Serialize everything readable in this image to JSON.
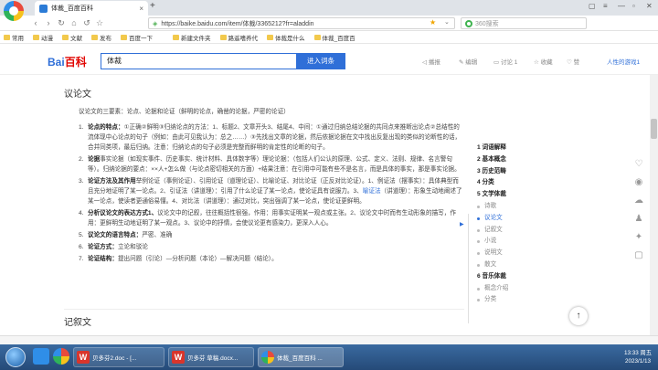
{
  "browser": {
    "tab_title": "体裁_百度百科",
    "url": "https://baike.baidu.com/item/体裁/3365212?fr=aladdin",
    "search_placeholder": "360搜索",
    "bookmarks": [
      "常用",
      "动漫",
      "文献",
      "发布",
      "百度一下",
      "新建文件夹",
      "路遥嗜养代",
      "体裁是什么",
      "体裁_百度百"
    ]
  },
  "header": {
    "logo": "Bai",
    "logo_suffix": "百科",
    "search_value": "体裁",
    "enter_button": "进入词条",
    "actions": [
      "播报",
      "编辑",
      "讨论 1",
      "收藏",
      "赞"
    ],
    "right_link": "人性的游戏1"
  },
  "article": {
    "section_title": "议论文",
    "intro": "议论文的三要素：论点、论据和论证（鲜明的论点，确凿的论据，严密的论证）",
    "items": [
      {
        "n": "1.",
        "head": "论点的特点：",
        "body": "①正确②鲜明③归纳论点的方法：1、标题2、文章开头3、结尾4、中间：①通过归纳总结论据的共同点来推断出论点②总结性的流体现中心论点的句子（例如：由此可见我认为：总之……）③先找出文章的论据，然后依据论据在文中找出反复出现的类似的论断性的话，合并同类项，最后归纳。注意：归纳论点的句子必须是完整而鲜明的肯定性的论断的句子。"
      },
      {
        "n": "2.",
        "head": "论据",
        "body": "事实论据（如现实事件、历史事实、统计材料、具体数字等）理论论据：（包括人们公认的原理、公式、定义、法则、规律、名言警句等）。归纳论据的要点：××人+怎么做（与论点密切相关的方面）+结果注意：在引用中可能有些不是名言，而是具体的事实，那是事实论据。"
      },
      {
        "n": "3.",
        "head": "论证方法及其作用",
        "body": "举例论证（事例论证）、引用论证（道理论证）、比喻论证、对比论证（正反对比论证）。1、例证法（摆事实）：具体典型而且充分地证明了某一论点。2、引证法（讲道理）：引用了什么论证了某一论点，使论证具有说服力。3、",
        "link": "喻证法",
        "body2": "（讲道理）：形象生动地阐述了某一论点，使读者更通俗易懂。4、对比法（讲道理）：通过对比，突出强调了某一论点，使论证更鲜明。"
      },
      {
        "n": "4.",
        "head": "分析议论文的表达方式1、",
        "body": "议论文中的记叙，往往概括性很强，作用：用事实证明某一观点或主张。2、议论文中时而有生动形象的描写，作用：更鲜明生动地证明了某一观点。3、议论中的抒情，会使议论更有感染力，更深入人心。"
      },
      {
        "n": "5.",
        "head": "议论文的语言特点：",
        "body": "严密、准确"
      },
      {
        "n": "6.",
        "head": "论证方式：",
        "body": "立论和驳论"
      },
      {
        "n": "7.",
        "head": "论证结构：",
        "body": "提出问题（引论）—分析问题（本论）—解决问题（结论）。"
      }
    ],
    "next_section_title": "记叙文"
  },
  "toc": [
    {
      "label": "1  词语解释",
      "kind": "main"
    },
    {
      "label": "2  基本概念",
      "kind": "main"
    },
    {
      "label": "3  历史范畴",
      "kind": "main"
    },
    {
      "label": "4  分类",
      "kind": "main"
    },
    {
      "label": "5  文学体裁",
      "kind": "main"
    },
    {
      "label": "诗歌",
      "kind": "sub"
    },
    {
      "label": "议论文",
      "kind": "active"
    },
    {
      "label": "记叙文",
      "kind": "sub"
    },
    {
      "label": "小说",
      "kind": "sub"
    },
    {
      "label": "说明文",
      "kind": "sub"
    },
    {
      "label": "散文",
      "kind": "sub"
    },
    {
      "label": "6  音乐体裁",
      "kind": "main"
    },
    {
      "label": "概念介绍",
      "kind": "sub"
    },
    {
      "label": "分类",
      "kind": "sub"
    }
  ],
  "taskbar": {
    "apps": [
      "贝多芬2.doc - [...",
      "贝多芬 草稿.docx...",
      "体裁_百度百科 ..."
    ],
    "time": "13:33 周五",
    "date": "2023/1/13"
  }
}
